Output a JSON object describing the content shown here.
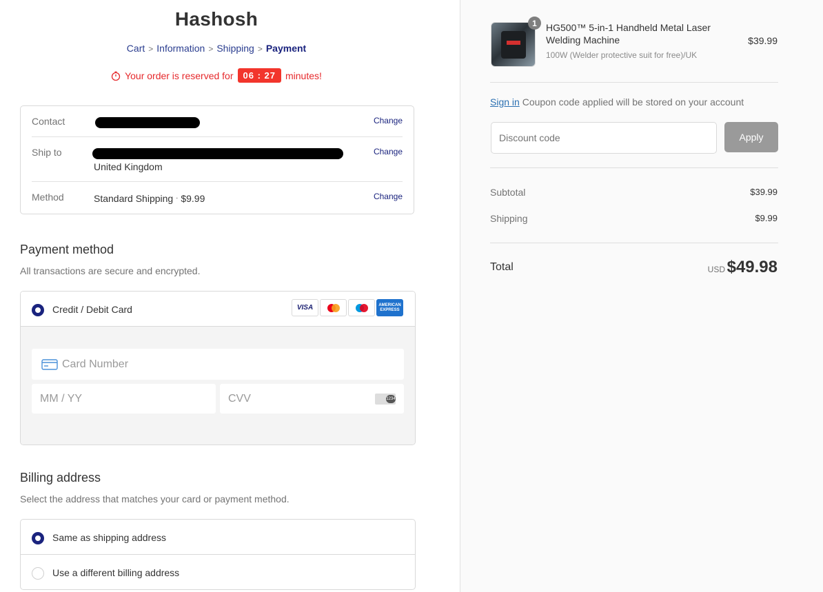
{
  "store": {
    "name": "Hashosh"
  },
  "breadcrumb": [
    {
      "label": "Cart"
    },
    {
      "label": "Information"
    },
    {
      "label": "Shipping"
    },
    {
      "label": "Payment"
    }
  ],
  "timer": {
    "prefix": "Your order is reserved for",
    "count": "06 : 27",
    "suffix": "minutes!"
  },
  "review": {
    "contact": {
      "label": "Contact",
      "change": "Change"
    },
    "ship_to": {
      "label": "Ship to",
      "country": "United Kingdom",
      "change": "Change"
    },
    "method": {
      "label": "Method",
      "value": "Standard Shipping",
      "dot": "·",
      "price": "$9.99",
      "change": "Change"
    }
  },
  "payment": {
    "title": "Payment method",
    "subtitle": "All transactions are secure and encrypted.",
    "option_label": "Credit / Debit Card",
    "card_logos": [
      "VISA",
      "AMERICAN EXPRESS"
    ],
    "card_number_placeholder": "Card Number",
    "expiry_placeholder": "MM / YY",
    "cvv_placeholder": "CVV",
    "cvv_hint": "1234"
  },
  "billing": {
    "title": "Billing address",
    "subtitle": "Select the address that matches your card or payment method.",
    "options": [
      {
        "label": "Same as shipping address",
        "selected": true
      },
      {
        "label": "Use a different billing address",
        "selected": false
      }
    ]
  },
  "summary": {
    "product": {
      "quantity": "1",
      "name": "HG500™ 5-in-1 Handheld Metal Laser Welding Machine",
      "variant": "100W (Welder protective suit for free)/UK",
      "price": "$39.99"
    },
    "sign_in": {
      "link": "Sign in",
      "text": "Coupon code applied will be stored on your account"
    },
    "discount_placeholder": "Discount code",
    "apply_label": "Apply",
    "subtotal_label": "Subtotal",
    "subtotal_value": "$39.99",
    "shipping_label": "Shipping",
    "shipping_value": "$9.99",
    "total_label": "Total",
    "currency": "USD",
    "total_value": "$49.98"
  },
  "colors": {
    "accent": "#1a237e",
    "timer": "#f2352c",
    "link": "#2a6fb1",
    "apply_bg": "#9a9a9a"
  }
}
